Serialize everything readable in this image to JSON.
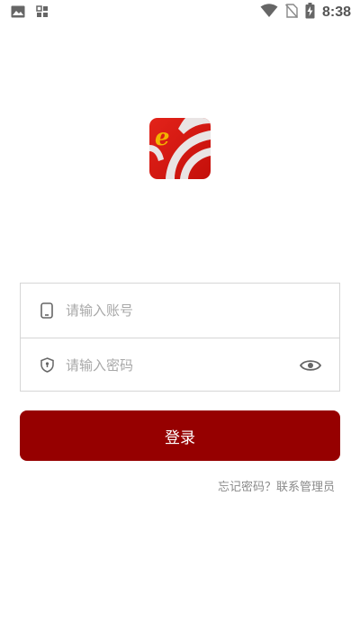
{
  "status_bar": {
    "time": "8:38",
    "icons": [
      "image-icon",
      "apps-grid-icon",
      "wifi-icon",
      "no-sim-icon",
      "battery-charging-icon"
    ]
  },
  "logo": {
    "icon": "app-logo-e-icon",
    "letter": "e",
    "colors": {
      "red": "#d7160f",
      "gold": "#f3b300"
    }
  },
  "form": {
    "account": {
      "icon": "phone-icon",
      "placeholder": "请输入账号",
      "value": ""
    },
    "password": {
      "icon": "shield-lock-icon",
      "placeholder": "请输入密码",
      "value": "",
      "toggle_icon": "eye-icon"
    }
  },
  "login_button": {
    "label": "登录",
    "color": "#960000"
  },
  "forgot_link": {
    "label": "忘记密码？联系管理员"
  }
}
